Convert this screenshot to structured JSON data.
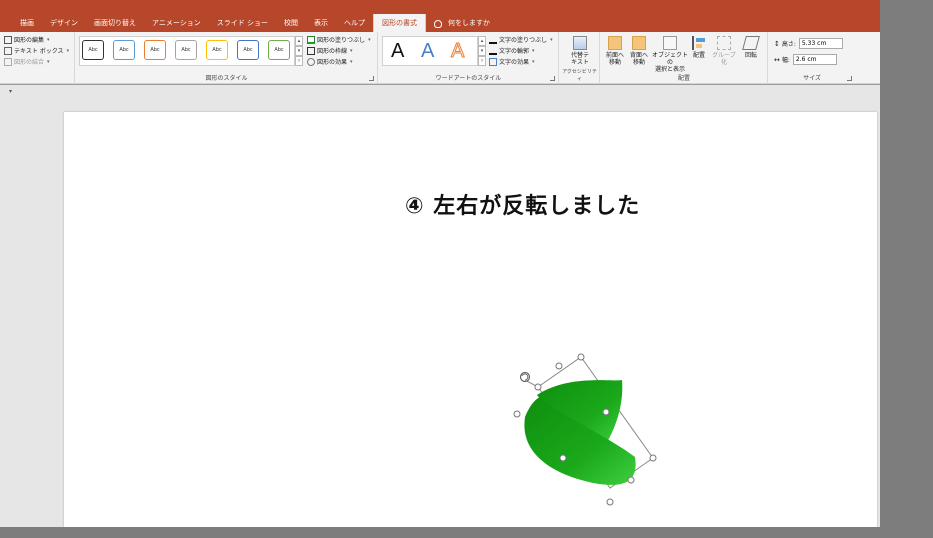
{
  "tabs": [
    {
      "label": "描画"
    },
    {
      "label": "デザイン"
    },
    {
      "label": "画面切り替え"
    },
    {
      "label": "アニメーション"
    },
    {
      "label": "スライド ショー"
    },
    {
      "label": "校閲"
    },
    {
      "label": "表示"
    },
    {
      "label": "ヘルプ"
    },
    {
      "label": "図形の書式",
      "active": true
    }
  ],
  "tell_me": "何をしますか",
  "insert_shapes": {
    "edit_shape": "図形の編集",
    "text_box": "テキスト ボックス",
    "merge_shapes": "図形の結合"
  },
  "shape_styles": {
    "group_label": "図形のスタイル",
    "sample_text": "Abc",
    "swatches": [
      "#333333",
      "#5b9bd5",
      "#ed7d31",
      "#a5a5a5",
      "#ffc000",
      "#4472c4",
      "#70ad47"
    ],
    "fill": "図形の塗りつぶし",
    "outline": "図形の枠線",
    "effects": "図形の効果"
  },
  "wordart": {
    "group_label": "ワードアートのスタイル",
    "letters": [
      "A",
      "A",
      "A"
    ],
    "text_fill": "文字の塗りつぶし",
    "text_outline": "文字の輪郭",
    "text_effects": "文字の効果"
  },
  "accessibility": {
    "group_label": "アクセシビリティ",
    "alt_text_line1": "代替テ",
    "alt_text_line2": "キスト"
  },
  "arrange": {
    "group_label": "配置",
    "bring_forward_1": "前面へ",
    "bring_forward_2": "移動",
    "send_backward_1": "背面へ",
    "send_backward_2": "移動",
    "selection_pane_1": "オブジェクトの",
    "selection_pane_2": "選択と表示",
    "align": "配置",
    "group": "グループ化",
    "rotate": "回転"
  },
  "size": {
    "group_label": "サイズ",
    "height_label": "高さ:",
    "height_value": "5.33 cm",
    "width_label": "幅:",
    "width_value": "2.6 cm"
  },
  "slide": {
    "title": "④ 左右が反転しました"
  },
  "colors": {
    "accent": "#b7472a",
    "shape_green": "#1aa01a"
  }
}
